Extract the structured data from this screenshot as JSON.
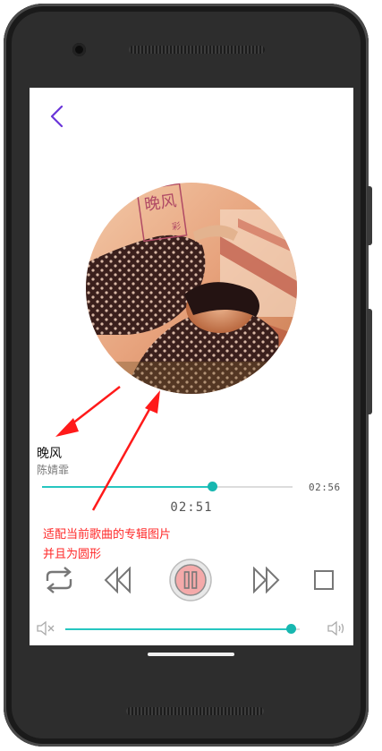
{
  "song": {
    "title": "晚风",
    "artist": "陈婧霏",
    "duration": "02:56",
    "current_time": "02:51",
    "progress": 0.68
  },
  "volume": {
    "level": 0.96
  },
  "annotation": {
    "line1": "适配当前歌曲的专辑图片",
    "line2": "并且为圆形"
  },
  "album_art": {
    "stamp_text": "晚风",
    "stamp_small": "彩"
  },
  "icons": {
    "back": "chevron-left-icon",
    "repeat": "repeat-icon",
    "previous": "rewind-icon",
    "pause": "pause-icon",
    "next": "fast-forward-icon",
    "stop": "stop-icon",
    "mute": "volume-mute-icon",
    "volume": "volume-up-icon"
  },
  "colors": {
    "accent": "#26c6c0",
    "back_arrow": "#6a35d9",
    "annotation": "#ff2a2a",
    "pause_button": "#f4aaaa"
  }
}
